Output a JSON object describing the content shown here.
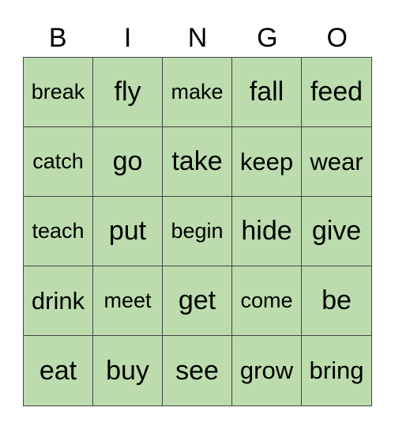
{
  "header": {
    "letters": [
      "B",
      "I",
      "N",
      "G",
      "O"
    ]
  },
  "colors": {
    "cell_background": "#bcdcad",
    "grid_line": "#444444"
  },
  "board": {
    "rows": [
      [
        "break",
        "fly",
        "make",
        "fall",
        "feed"
      ],
      [
        "catch",
        "go",
        "take",
        "keep",
        "wear"
      ],
      [
        "teach",
        "put",
        "begin",
        "hide",
        "give"
      ],
      [
        "drink",
        "meet",
        "get",
        "come",
        "be"
      ],
      [
        "eat",
        "buy",
        "see",
        "grow",
        "bring"
      ]
    ]
  }
}
